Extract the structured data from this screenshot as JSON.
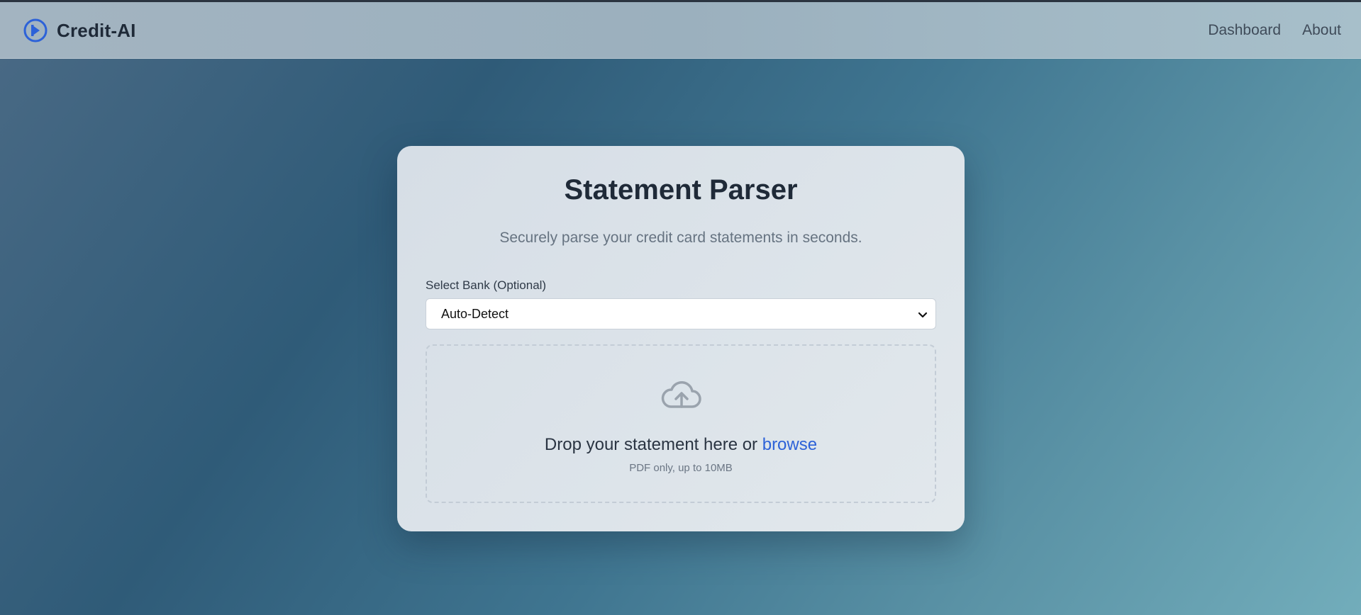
{
  "navbar": {
    "brand": "Credit-AI",
    "links": [
      "Dashboard",
      "About"
    ]
  },
  "card": {
    "title": "Statement Parser",
    "subtitle": "Securely parse your credit card statements in seconds.",
    "bank_label": "Select Bank (Optional)",
    "bank_selected": "Auto-Detect",
    "dropzone": {
      "text": "Drop your statement here or ",
      "browse": "browse",
      "hint": "PDF only, up to 10MB"
    }
  },
  "icons": {
    "logo": "circle-play-icon",
    "upload": "cloud-upload-icon",
    "select": "chevron-down-icon"
  },
  "colors": {
    "accent": "#2d62d8",
    "brand_text": "#1f2a38"
  }
}
